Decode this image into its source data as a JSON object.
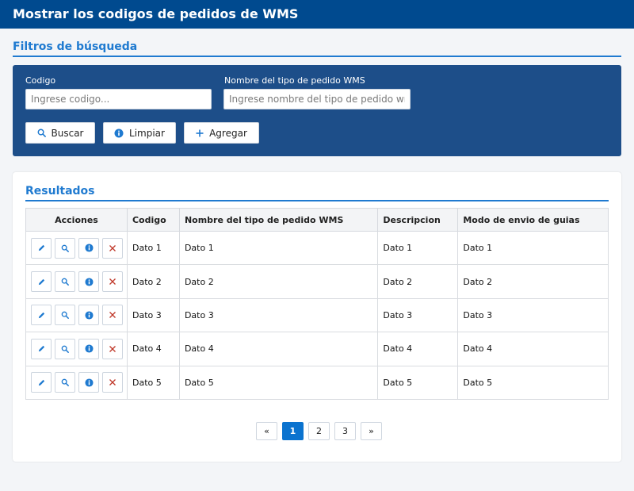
{
  "header": {
    "title": "Mostrar los codigos de pedidos de WMS"
  },
  "filters": {
    "title": "Filtros de búsqueda",
    "codigo": {
      "label": "Codigo",
      "placeholder": "Ingrese codigo...",
      "value": ""
    },
    "nombre": {
      "label": "Nombre del tipo de pedido WMS",
      "placeholder": "Ingrese nombre del tipo de pedido wms",
      "value": ""
    },
    "buttons": {
      "buscar": {
        "label": "Buscar",
        "icon": "search-icon"
      },
      "limpiar": {
        "label": "Limpiar",
        "icon": "info-circle-icon"
      },
      "agregar": {
        "label": "Agregar",
        "icon": "plus-icon"
      }
    }
  },
  "results": {
    "title": "Resultados",
    "columns": [
      "Acciones",
      "Codigo",
      "Nombre del tipo de pedido WMS",
      "Descripcion",
      "Modo de envio de guias"
    ],
    "rows": [
      [
        "Dato 1",
        "Dato 1",
        "Dato 1",
        "Dato 1"
      ],
      [
        "Dato 2",
        "Dato 2",
        "Dato 2",
        "Dato 2"
      ],
      [
        "Dato 3",
        "Dato 3",
        "Dato 3",
        "Dato 3"
      ],
      [
        "Dato 4",
        "Dato 4",
        "Dato 4",
        "Dato 4"
      ],
      [
        "Dato 5",
        "Dato 5",
        "Dato 5",
        "Dato 5"
      ]
    ],
    "row_actions": [
      "edit-icon",
      "search-icon",
      "info-icon",
      "delete-icon"
    ]
  },
  "pagination": {
    "prev": "«",
    "pages": [
      "1",
      "2",
      "3"
    ],
    "current": "1",
    "next": "»"
  },
  "colors": {
    "brand": "#004a8f",
    "panel": "#1d4e89",
    "accent": "#1f7ad0",
    "active_page": "#0b73cf",
    "delete": "#c0392b"
  }
}
